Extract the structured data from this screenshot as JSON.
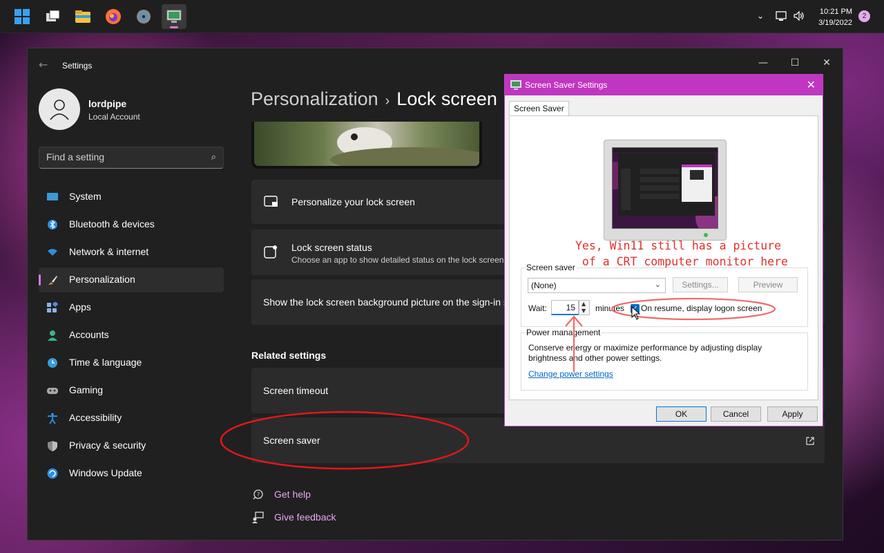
{
  "taskbar": {
    "apps": [
      {
        "name": "start"
      },
      {
        "name": "task-view"
      },
      {
        "name": "file-explorer"
      },
      {
        "name": "firefox"
      },
      {
        "name": "settings"
      },
      {
        "name": "screen-saver"
      }
    ],
    "time": "10:21 PM",
    "date": "3/19/2022",
    "notifications": "2"
  },
  "settings": {
    "title": "Settings",
    "user": {
      "name": "lordpipe",
      "type": "Local Account"
    },
    "search_placeholder": "Find a setting",
    "nav": [
      {
        "label": "System",
        "icon": "system-icon",
        "color": "#3a9ad9"
      },
      {
        "label": "Bluetooth & devices",
        "icon": "bluetooth-icon",
        "color": "#2b8ee0"
      },
      {
        "label": "Network & internet",
        "icon": "wifi-icon",
        "color": "#2b8ee0"
      },
      {
        "label": "Personalization",
        "icon": "brush-icon",
        "color": "#e08a4a"
      },
      {
        "label": "Apps",
        "icon": "apps-icon",
        "color": "#8ab4e8"
      },
      {
        "label": "Accounts",
        "icon": "accounts-icon",
        "color": "#3bb28f"
      },
      {
        "label": "Time & language",
        "icon": "time-icon",
        "color": "#3a9ad9"
      },
      {
        "label": "Gaming",
        "icon": "gaming-icon",
        "color": "#aaaaaa"
      },
      {
        "label": "Accessibility",
        "icon": "accessibility-icon",
        "color": "#2b8ee0"
      },
      {
        "label": "Privacy & security",
        "icon": "shield-icon",
        "color": "#8a8a8a"
      },
      {
        "label": "Windows Update",
        "icon": "update-icon",
        "color": "#2b8ee0"
      }
    ],
    "breadcrumb": {
      "parent": "Personalization",
      "separator": "›",
      "current": "Lock screen"
    },
    "cards": {
      "personalize": {
        "title": "Personalize your lock screen"
      },
      "status": {
        "title": "Lock screen status",
        "subtitle": "Choose an app to show detailed status on the lock screen"
      },
      "signin": {
        "title": "Show the lock screen background picture on the sign-in screen"
      }
    },
    "related_heading": "Related settings",
    "related": {
      "timeout": "Screen timeout",
      "saver": "Screen saver"
    },
    "help": "Get help",
    "feedback": "Give feedback"
  },
  "dialog": {
    "title": "Screen Saver Settings",
    "tab": "Screen Saver",
    "screen_saver_group": "Screen saver",
    "selected_saver": "(None)",
    "settings_btn": "Settings...",
    "preview_btn": "Preview",
    "wait_label": "Wait:",
    "wait_value": "15",
    "minutes_label": "minutes",
    "resume_label": "On resume, display logon screen",
    "resume_checked": true,
    "power_group": "Power management",
    "power_desc_1": "Conserve energy or maximize performance by adjusting display",
    "power_desc_2": "brightness and other power settings.",
    "power_link": "Change power settings",
    "ok": "OK",
    "cancel": "Cancel",
    "apply": "Apply"
  },
  "annotation": {
    "line1": "Yes, Win11 still has a picture",
    "line2": " of a CRT computer monitor here"
  }
}
